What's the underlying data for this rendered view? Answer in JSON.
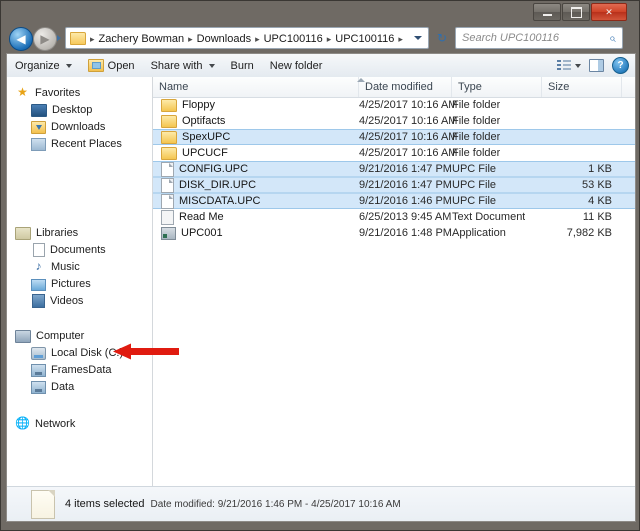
{
  "window": {
    "controls": {
      "minimize": "Minimize",
      "maximize": "Maximize",
      "close": "Close",
      "close_glyph": "✕"
    }
  },
  "navigation": {
    "back_label": "Back",
    "back_glyph": "◀",
    "forward_label": "Forward",
    "forward_glyph": "▶",
    "refresh_label": "Refresh",
    "refresh_glyph": "↻",
    "breadcrumbs": [
      "Zachery Bowman",
      "Downloads",
      "UPC100116",
      "UPC100116"
    ],
    "separator": "▸"
  },
  "search": {
    "placeholder": "Search UPC100116",
    "value": "",
    "icon_glyph": "⌕"
  },
  "toolbar": {
    "organize": "Organize",
    "open": "Open",
    "share_with": "Share with",
    "burn": "Burn",
    "new_folder": "New folder",
    "view_label": "Change your view",
    "preview_label": "Show the preview pane",
    "help_label": "Get help",
    "help_glyph": "?"
  },
  "sidebar": {
    "groups": [
      {
        "title": "Favorites",
        "icon": "star-icon",
        "items": [
          {
            "label": "Desktop",
            "icon": "desktop-icon"
          },
          {
            "label": "Downloads",
            "icon": "downloads-folder-icon"
          },
          {
            "label": "Recent Places",
            "icon": "recent-places-icon"
          }
        ]
      },
      {
        "title": "Libraries",
        "icon": "libraries-icon",
        "items": [
          {
            "label": "Documents",
            "icon": "document-icon"
          },
          {
            "label": "Music",
            "icon": "music-note-icon"
          },
          {
            "label": "Pictures",
            "icon": "picture-icon"
          },
          {
            "label": "Videos",
            "icon": "video-icon"
          }
        ]
      },
      {
        "title": "Computer",
        "icon": "computer-icon",
        "items": [
          {
            "label": "Local Disk (C:)",
            "icon": "hard-disk-icon"
          },
          {
            "label": "FramesData",
            "icon": "network-drive-icon"
          },
          {
            "label": "Data",
            "icon": "network-drive-icon"
          }
        ]
      },
      {
        "title": "Network",
        "icon": "network-icon",
        "items": []
      }
    ],
    "music_glyph": "♪",
    "network_glyph": "🌐"
  },
  "filelist": {
    "columns": [
      "Name",
      "Date modified",
      "Type",
      "Size"
    ],
    "rows": [
      {
        "name": "Floppy",
        "date": "4/25/2017 10:16 AM",
        "type": "File folder",
        "size": "",
        "icon": "folder-icon",
        "selected": false
      },
      {
        "name": "Optifacts",
        "date": "4/25/2017 10:16 AM",
        "type": "File folder",
        "size": "",
        "icon": "folder-icon",
        "selected": false
      },
      {
        "name": "SpexUPC",
        "date": "4/25/2017 10:16 AM",
        "type": "File folder",
        "size": "",
        "icon": "folder-icon",
        "selected": true
      },
      {
        "name": "UPCUCF",
        "date": "4/25/2017 10:16 AM",
        "type": "File folder",
        "size": "",
        "icon": "folder-icon",
        "selected": false
      },
      {
        "name": "CONFIG.UPC",
        "date": "9/21/2016 1:47 PM",
        "type": "UPC File",
        "size": "1 KB",
        "icon": "file-icon",
        "selected": true
      },
      {
        "name": "DISK_DIR.UPC",
        "date": "9/21/2016 1:47 PM",
        "type": "UPC File",
        "size": "53 KB",
        "icon": "file-icon",
        "selected": true
      },
      {
        "name": "MISCDATA.UPC",
        "date": "9/21/2016 1:46 PM",
        "type": "UPC File",
        "size": "4 KB",
        "icon": "file-icon",
        "selected": true
      },
      {
        "name": "Read Me",
        "date": "6/25/2013 9:45 AM",
        "type": "Text Document",
        "size": "11 KB",
        "icon": "text-document-icon",
        "selected": false
      },
      {
        "name": "UPC001",
        "date": "9/21/2016 1:48 PM",
        "type": "Application",
        "size": "7,982 KB",
        "icon": "application-icon",
        "selected": false
      }
    ]
  },
  "statusbar": {
    "selection": "4 items selected",
    "detail": "Date modified: 9/21/2016 1:46 PM - 4/25/2017 10:16 AM"
  },
  "annotation": {
    "arrow_color": "#e01b10",
    "arrow_direction": "left",
    "points_at": "Local Disk (C:)"
  },
  "colors": {
    "selection": "#d3e7f9",
    "frame": "#6f6a64",
    "accent": "#2f6fae",
    "close": "#cf4226"
  }
}
